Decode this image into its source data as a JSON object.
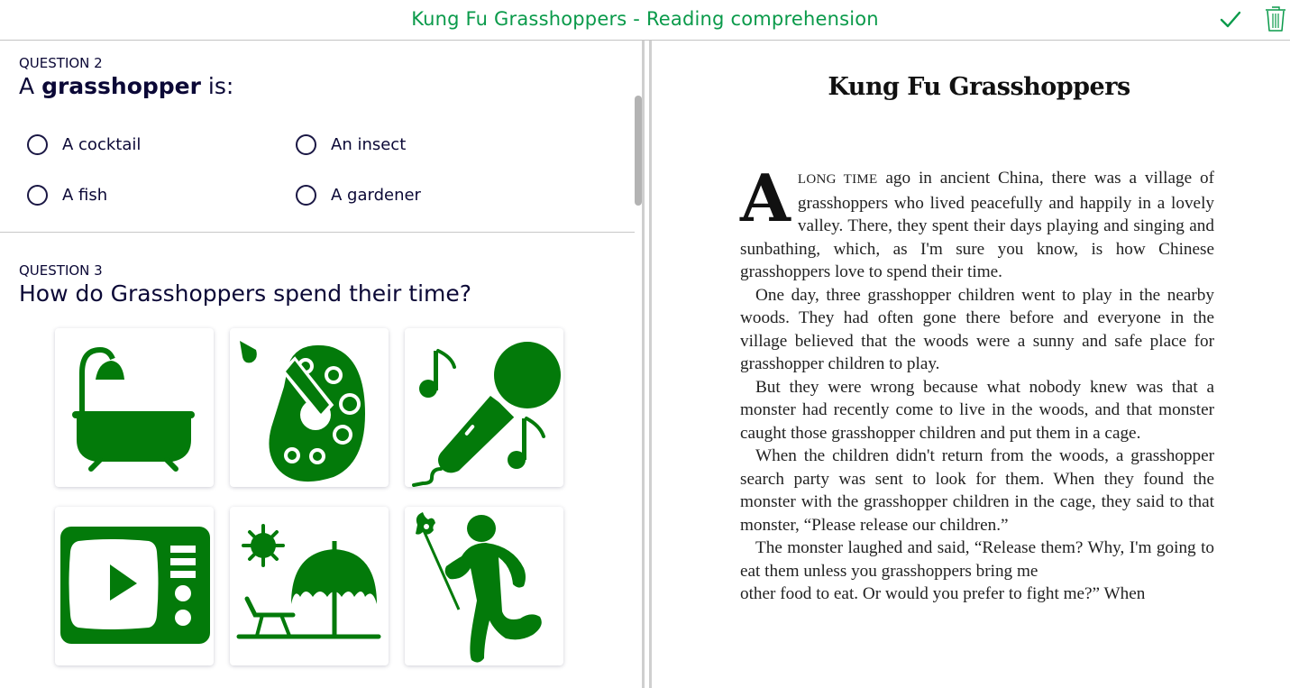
{
  "header": {
    "title": "Kung Fu Grasshoppers - Reading comprehension",
    "accent_color": "#0a9a4a",
    "check_icon": "checkmark-icon",
    "trash_icon": "trash-icon"
  },
  "questions": [
    {
      "label": "QUESTION 2",
      "title_prefix": "A ",
      "title_bold": "grasshopper",
      "title_suffix": " is:",
      "options": [
        {
          "label": "A cocktail",
          "selected": false
        },
        {
          "label": "An insect",
          "selected": false
        },
        {
          "label": "A fish",
          "selected": false
        },
        {
          "label": "A gardener",
          "selected": false
        }
      ]
    },
    {
      "label": "QUESTION 3",
      "title": "How do Grasshoppers spend their time?",
      "icon_color": "#037a0a",
      "image_options": [
        {
          "icon": "bathtub-icon",
          "meaning": "bathing"
        },
        {
          "icon": "paint-palette-icon",
          "meaning": "painting"
        },
        {
          "icon": "microphone-singing-icon",
          "meaning": "singing"
        },
        {
          "icon": "tv-icon",
          "meaning": "watching TV"
        },
        {
          "icon": "beach-umbrella-icon",
          "meaning": "sunbathing"
        },
        {
          "icon": "playing-child-icon",
          "meaning": "playing"
        }
      ]
    }
  ],
  "story": {
    "title": "Kung Fu Grasshoppers",
    "dropcap": "A",
    "opening_smallcaps": "LONG TIME",
    "paragraphs": [
      " ago in ancient China, there was a village of grasshoppers who lived peacefully and happily in a lovely valley. There, they spent their days playing and singing and sunbathing, which, as I'm sure you know, is how Chinese grasshoppers love to spend their time.",
      "One day, three grasshopper children went to play in the nearby woods. They had often gone there before and everyone in the village believed that the woods were a sunny and safe place for grasshopper children to play.",
      "But they were wrong because what nobody knew was that a monster had recently come to live in the woods, and that monster caught those grasshopper children and put them in a cage.",
      "When the children didn't return from the woods, a grasshopper search party was sent to look for them. When they found the monster with the grasshopper children in the cage, they said to that monster, “Please release our children.”",
      "The monster laughed and said, “Release them? Why, I'm going to eat them unless you grasshoppers bring me",
      "other food to eat. Or would you prefer to fight me?” When"
    ]
  }
}
